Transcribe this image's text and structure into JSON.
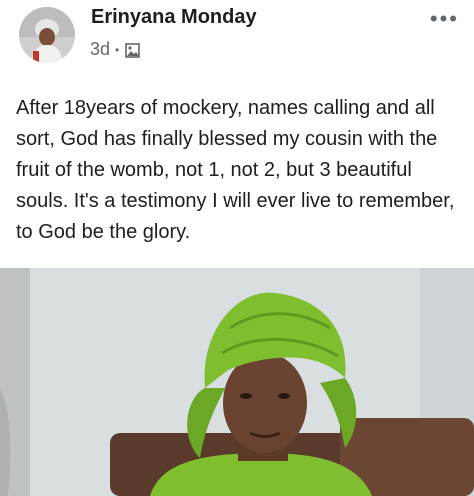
{
  "post": {
    "author_name": "Erinyana Monday",
    "timestamp": "3d",
    "separator": "•",
    "privacy_icon": "photo-icon",
    "more_label": "•••",
    "text": "After 18years of mockery, names calling and all sort, God has finally blessed my cousin with the fruit of the womb, not 1, not 2, but 3 beautiful souls. It's a testimony I will ever live to remember, to God be the glory."
  },
  "colors": {
    "author": "#1c1e21",
    "meta": "#65676b",
    "headwrap": "#7fbf2f",
    "background_wall": "#d8dde0"
  }
}
